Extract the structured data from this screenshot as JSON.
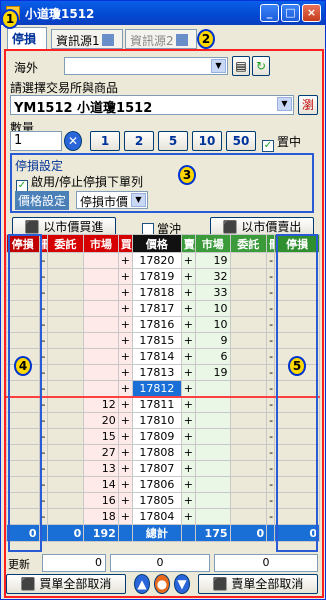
{
  "window": {
    "title": "小道瓊1512"
  },
  "tabs": [
    {
      "label": "停損"
    },
    {
      "label": "資訊源1"
    },
    {
      "label": "資訊源2"
    }
  ],
  "callouts": [
    "1",
    "2",
    "3",
    "4",
    "5"
  ],
  "account": {
    "label": "海外",
    "value": ""
  },
  "product": {
    "section_label": "請選擇交易所與商品",
    "value": "YM1512 小道瓊1512",
    "button": "瀏"
  },
  "quantity": {
    "label": "數量",
    "value": "1",
    "presets": [
      "1",
      "2",
      "5",
      "10",
      "50"
    ],
    "center_label": "置中",
    "center_checked": true
  },
  "stoploss": {
    "title": "停損設定",
    "enable_label": "啟用/停止停損下單列",
    "enabled": true,
    "price_label": "價格設定",
    "price_value": "停損市價"
  },
  "actions": {
    "buy_market": "以市價買進",
    "day_trade": "當沖",
    "sell_market": "以市價賣出"
  },
  "grid": {
    "headers": [
      "停損",
      "刪",
      "委託",
      "市場",
      "買",
      "價格",
      "賣",
      "市場",
      "委託",
      "刪",
      "停損"
    ],
    "rows": [
      {
        "buy_mkt": "",
        "price": "17820",
        "sell_mkt": "19"
      },
      {
        "buy_mkt": "",
        "price": "17819",
        "sell_mkt": "32"
      },
      {
        "buy_mkt": "",
        "price": "17818",
        "sell_mkt": "33"
      },
      {
        "buy_mkt": "",
        "price": "17817",
        "sell_mkt": "10"
      },
      {
        "buy_mkt": "",
        "price": "17816",
        "sell_mkt": "10"
      },
      {
        "buy_mkt": "",
        "price": "17815",
        "sell_mkt": "9"
      },
      {
        "buy_mkt": "",
        "price": "17814",
        "sell_mkt": "6"
      },
      {
        "buy_mkt": "",
        "price": "17813",
        "sell_mkt": "19"
      },
      {
        "buy_mkt": "",
        "price": "17812",
        "sell_mkt": "",
        "current": true
      },
      {
        "buy_mkt": "12",
        "price": "17811",
        "sell_mkt": ""
      },
      {
        "buy_mkt": "20",
        "price": "17810",
        "sell_mkt": ""
      },
      {
        "buy_mkt": "15",
        "price": "17809",
        "sell_mkt": ""
      },
      {
        "buy_mkt": "27",
        "price": "17808",
        "sell_mkt": ""
      },
      {
        "buy_mkt": "13",
        "price": "17807",
        "sell_mkt": ""
      },
      {
        "buy_mkt": "14",
        "price": "17806",
        "sell_mkt": ""
      },
      {
        "buy_mkt": "16",
        "price": "17805",
        "sell_mkt": ""
      },
      {
        "buy_mkt": "18",
        "price": "17804",
        "sell_mkt": ""
      }
    ],
    "dash": "-",
    "plus": "+",
    "totals": {
      "left_stop": "0",
      "left_order": "0",
      "buy_mkt": "192",
      "label": "總計",
      "sell_mkt": "175",
      "sell_order": "0",
      "right_stop": "0"
    }
  },
  "update": {
    "label": "更新",
    "values": [
      "0",
      "0",
      "0"
    ]
  },
  "bottom": {
    "cancel_buy": "買單全部取消",
    "cancel_sell": "賣單全部取消"
  },
  "colors": {
    "buy": "#d60000",
    "sell": "#3b9b3b",
    "current": "#1a6fd6"
  }
}
